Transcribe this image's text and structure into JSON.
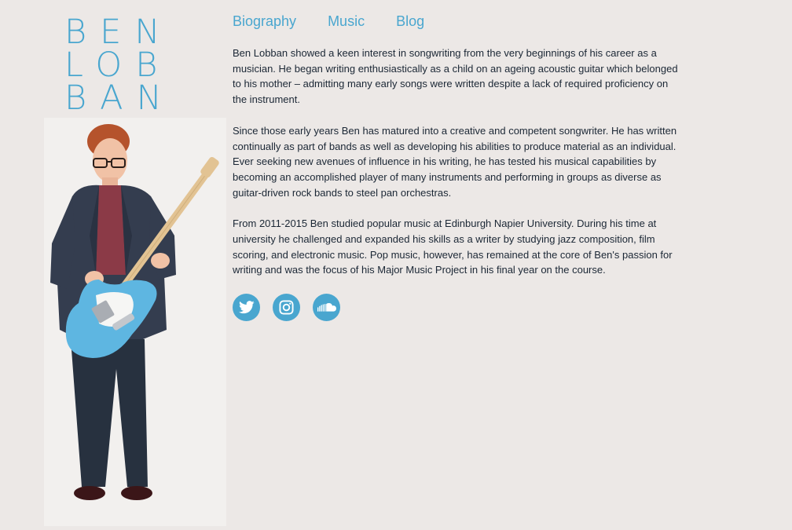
{
  "logo": {
    "lines": [
      "BEN",
      "LOB",
      "BAN"
    ]
  },
  "nav": {
    "items": [
      {
        "label": "Biography"
      },
      {
        "label": "Music"
      },
      {
        "label": "Blog"
      }
    ]
  },
  "bio": {
    "paragraphs": [
      "Ben Lobban showed a keen interest in songwriting from the very beginnings of his career as a musician. He began writing enthusiastically as a child on an ageing acoustic guitar which belonged to his mother – admitting many early songs were written despite a lack of required proficiency on the instrument.",
      "Since those early years Ben has matured into a creative and competent songwriter. He has written continually as part of bands as well as developing his abilities to produce material as an individual. Ever seeking new avenues of influence in his writing, he has tested his musical capabilities by becoming an accomplished player of many instruments and performing in groups as diverse as guitar-driven rock bands to steel pan orchestras.",
      "From 2011-2015 Ben studied popular music at Edinburgh Napier University. During his time at university he challenged and expanded his skills as a writer by studying jazz composition, film scoring, and electronic music. Pop music, however, has remained at the core of Ben's passion for writing and was the focus of his Major Music Project in his final year on the course."
    ]
  },
  "social": {
    "icons": [
      "twitter-icon",
      "instagram-icon",
      "soundcloud-icon"
    ]
  },
  "colors": {
    "accent": "#49a6cf",
    "background": "#ece8e6",
    "text": "#1b2735"
  }
}
